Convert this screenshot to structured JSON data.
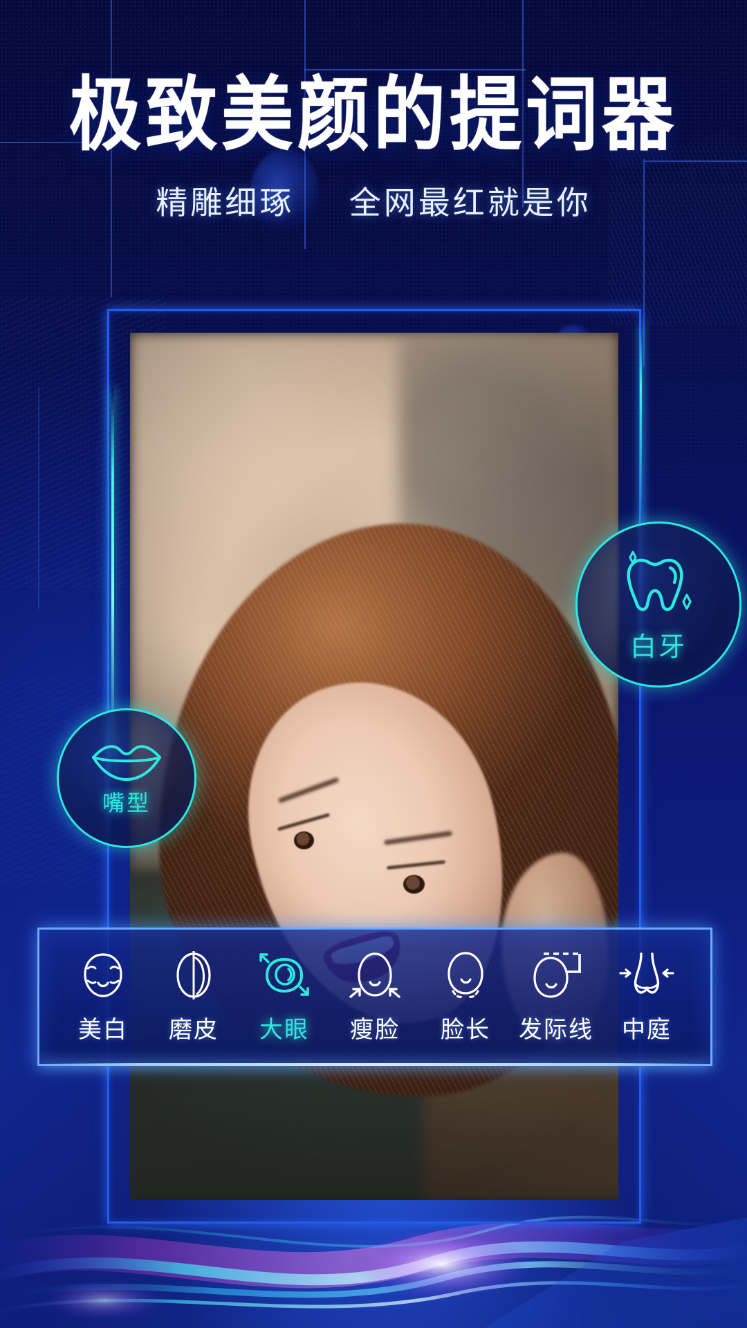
{
  "header": {
    "title": "极致美颜的提词器",
    "subtitle_left": "精雕细琢",
    "subtitle_right": "全网最红就是你"
  },
  "colors": {
    "accent_cyan": "#2ce8e0",
    "frame_blue": "#1f5cf0",
    "panel_border": "#69a9ff",
    "background_deep": "#06093a",
    "text_white": "#ffffff"
  },
  "badges": [
    {
      "id": "teeth",
      "label": "白牙",
      "icon": "tooth-icon"
    },
    {
      "id": "mouth",
      "label": "嘴型",
      "icon": "lips-icon"
    }
  ],
  "toolbar": {
    "items": [
      {
        "label": "美白",
        "icon": "face-whiten-icon",
        "active": false
      },
      {
        "label": "磨皮",
        "icon": "face-smooth-icon",
        "active": false
      },
      {
        "label": "大眼",
        "icon": "big-eye-icon",
        "active": true
      },
      {
        "label": "瘦脸",
        "icon": "slim-face-icon",
        "active": false
      },
      {
        "label": "脸长",
        "icon": "face-length-icon",
        "active": false
      },
      {
        "label": "发际线",
        "icon": "hairline-icon",
        "active": false
      },
      {
        "label": "中庭",
        "icon": "nose-midface-icon",
        "active": false
      }
    ]
  },
  "photo": {
    "alt": "smiling-woman-portrait"
  }
}
